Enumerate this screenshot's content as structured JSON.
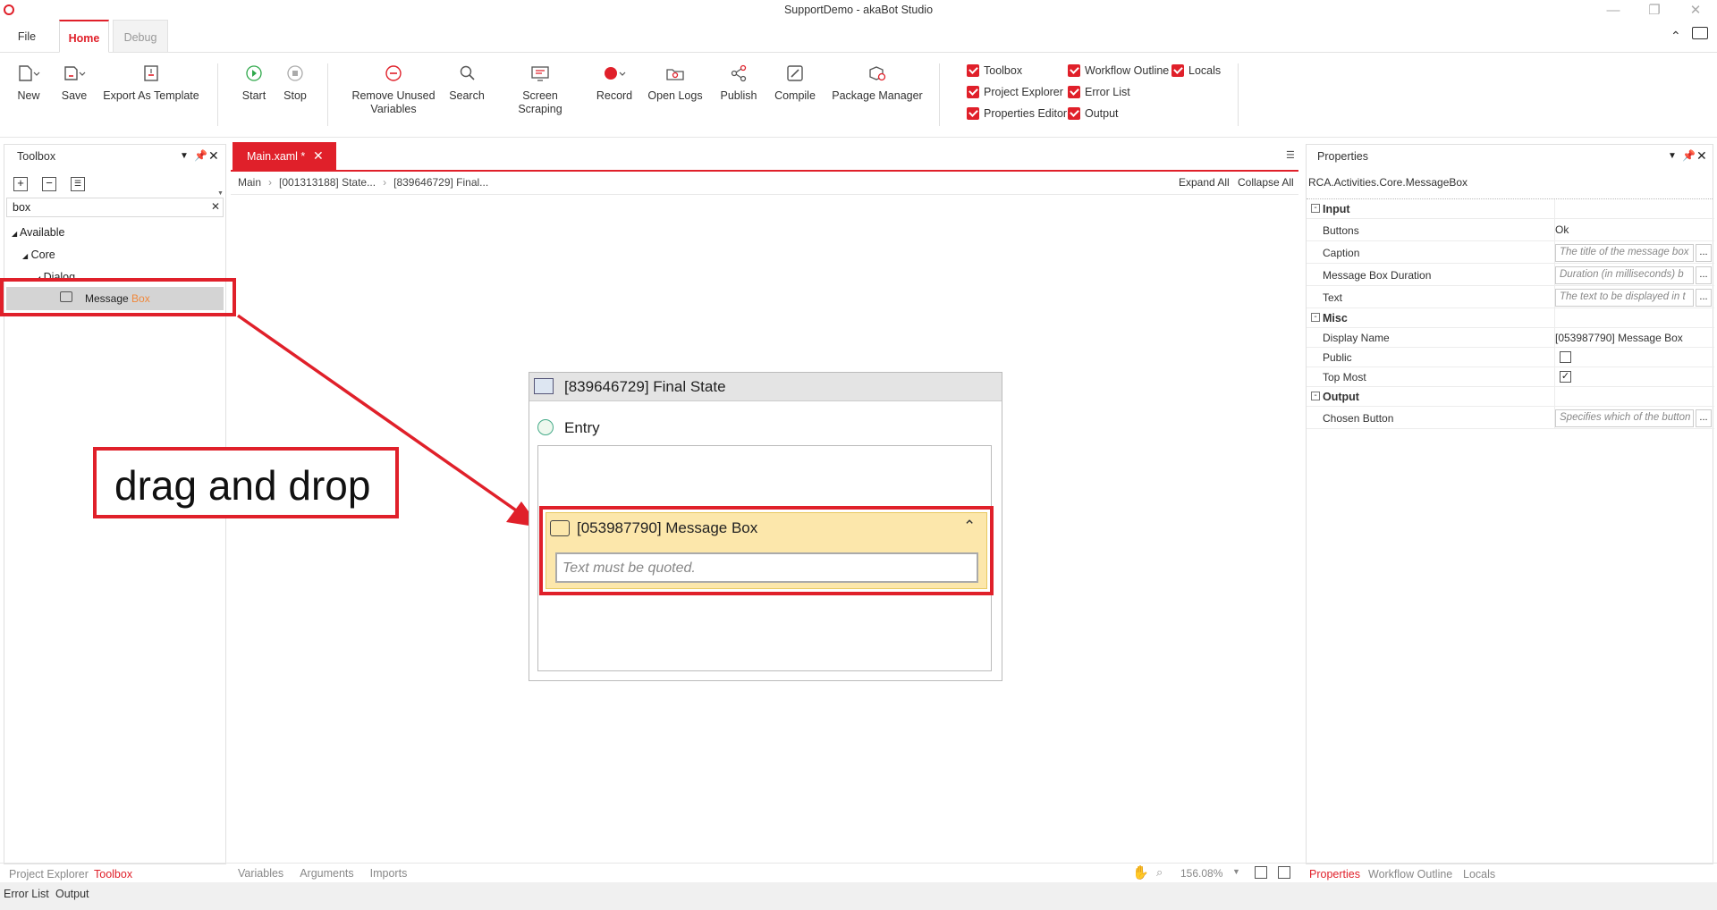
{
  "window": {
    "title": "SupportDemo - akaBot Studio"
  },
  "ribbon_tabs": [
    "File",
    "Home",
    "Debug"
  ],
  "ribbon": {
    "buttons": [
      {
        "label": "New",
        "icon": "new-file-icon"
      },
      {
        "label": "Save",
        "icon": "save-icon"
      },
      {
        "label": "Export As Template",
        "icon": "export-template-icon"
      },
      {
        "label": "Start",
        "icon": "play-icon"
      },
      {
        "label": "Stop",
        "icon": "stop-icon"
      },
      {
        "label": "Remove Unused Variables",
        "icon": "remove-variables-icon"
      },
      {
        "label": "Search",
        "icon": "search-icon"
      },
      {
        "label": "Screen Scraping",
        "icon": "screen-scraping-icon"
      },
      {
        "label": "Record",
        "icon": "record-icon"
      },
      {
        "label": "Open Logs",
        "icon": "open-logs-icon"
      },
      {
        "label": "Publish",
        "icon": "publish-icon"
      },
      {
        "label": "Compile",
        "icon": "compile-icon"
      },
      {
        "label": "Package Manager",
        "icon": "package-manager-icon"
      }
    ],
    "checkboxes": [
      {
        "label": "Toolbox",
        "checked": true
      },
      {
        "label": "Project Explorer",
        "checked": true
      },
      {
        "label": "Properties Editor",
        "checked": true
      },
      {
        "label": "Workflow Outline",
        "checked": true
      },
      {
        "label": "Error List",
        "checked": true
      },
      {
        "label": "Output",
        "checked": true
      },
      {
        "label": "Locals",
        "checked": true
      }
    ]
  },
  "toolbox": {
    "title": "Toolbox",
    "search_value": "box",
    "tree": {
      "available": "Available",
      "core": "Core",
      "dialog": "Dialog",
      "item_prefix": "Message ",
      "item_match": "Box"
    }
  },
  "editor": {
    "tab_label": "Main.xaml *",
    "breadcrumb": [
      "Main",
      "[001313188] State...",
      "[839646729] Final..."
    ],
    "expand_all": "Expand All",
    "collapse_all": "Collapse All",
    "state_title": "[839646729] Final State",
    "entry_label": "Entry",
    "activity_title": "[053987790] Message Box",
    "activity_placeholder": "Text must be quoted.",
    "annotation": "drag and drop",
    "bottom_tabs": [
      "Variables",
      "Arguments",
      "Imports"
    ],
    "zoom": "156.08%"
  },
  "properties": {
    "title": "Properties",
    "type_name": "RCA.Activities.Core.MessageBox",
    "sections": {
      "input": "Input",
      "misc": "Misc",
      "output": "Output"
    },
    "input_rows": [
      {
        "label": "Buttons",
        "value": "Ok",
        "placeholder": ""
      },
      {
        "label": "Caption",
        "value": "",
        "placeholder": "The title of the message box"
      },
      {
        "label": "Message Box Duration",
        "value": "",
        "placeholder": "Duration (in milliseconds) b"
      },
      {
        "label": "Text",
        "value": "",
        "placeholder": "The text to be displayed in t"
      }
    ],
    "misc_rows": [
      {
        "label": "Display Name",
        "value": "[053987790] Message Box"
      },
      {
        "label": "Public",
        "checked": false
      },
      {
        "label": "Top Most",
        "checked": true
      }
    ],
    "output_rows": [
      {
        "label": "Chosen Button",
        "placeholder": "Specifies which of the button"
      }
    ],
    "dots": "..."
  },
  "bottom_left_tabs": [
    "Project Explorer",
    "Toolbox"
  ],
  "bottom_left_tabs2": [
    "Error List",
    "Output"
  ],
  "bottom_right_tabs": [
    "Properties",
    "Workflow Outline",
    "Locals"
  ],
  "colors": {
    "accent": "#e0202a",
    "activity_bg": "#fbe6a8",
    "annotation_red": "#e0202a"
  }
}
